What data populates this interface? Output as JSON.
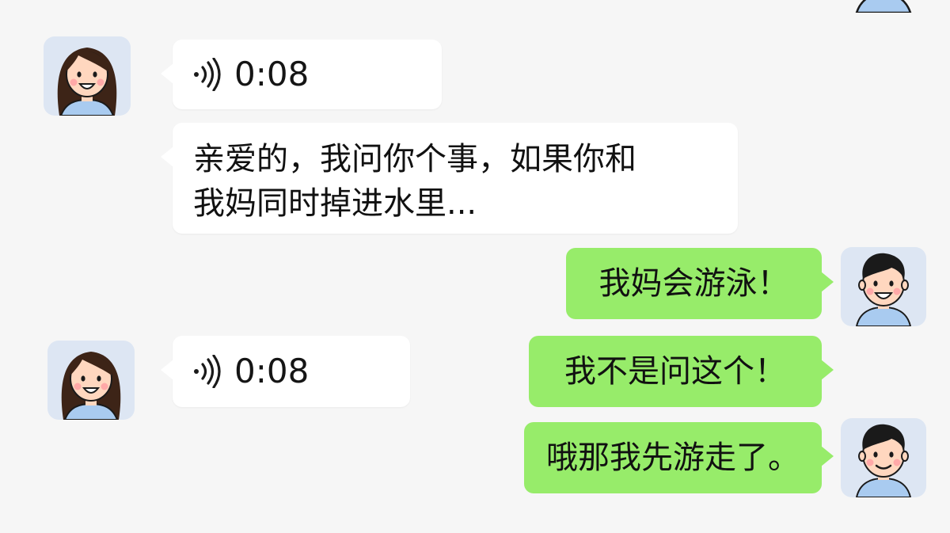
{
  "conversation": {
    "messages": [
      {
        "sender": "girlfriend",
        "side": "left",
        "type": "voice",
        "icon": "voice-wave-icon",
        "duration": "0:08"
      },
      {
        "sender": "girlfriend",
        "side": "left",
        "type": "text",
        "text": "亲爱的，我问你个事，如果你和\n我妈同时掉进水里..."
      },
      {
        "sender": "boyfriend",
        "side": "right",
        "type": "text",
        "text": "我妈会游泳！"
      },
      {
        "sender": "girlfriend",
        "side": "left",
        "type": "voice",
        "icon": "voice-wave-icon",
        "duration": "0:08"
      },
      {
        "sender": "boyfriend",
        "side": "right",
        "type": "text",
        "text": "我不是问这个！"
      },
      {
        "sender": "boyfriend",
        "side": "right",
        "type": "text",
        "text": "哦那我先游走了。"
      }
    ]
  },
  "colors": {
    "background": "#f6f6f6",
    "incoming_bubble": "#ffffff",
    "outgoing_bubble": "#97ec6a",
    "avatar_background": "#dde6f3"
  }
}
